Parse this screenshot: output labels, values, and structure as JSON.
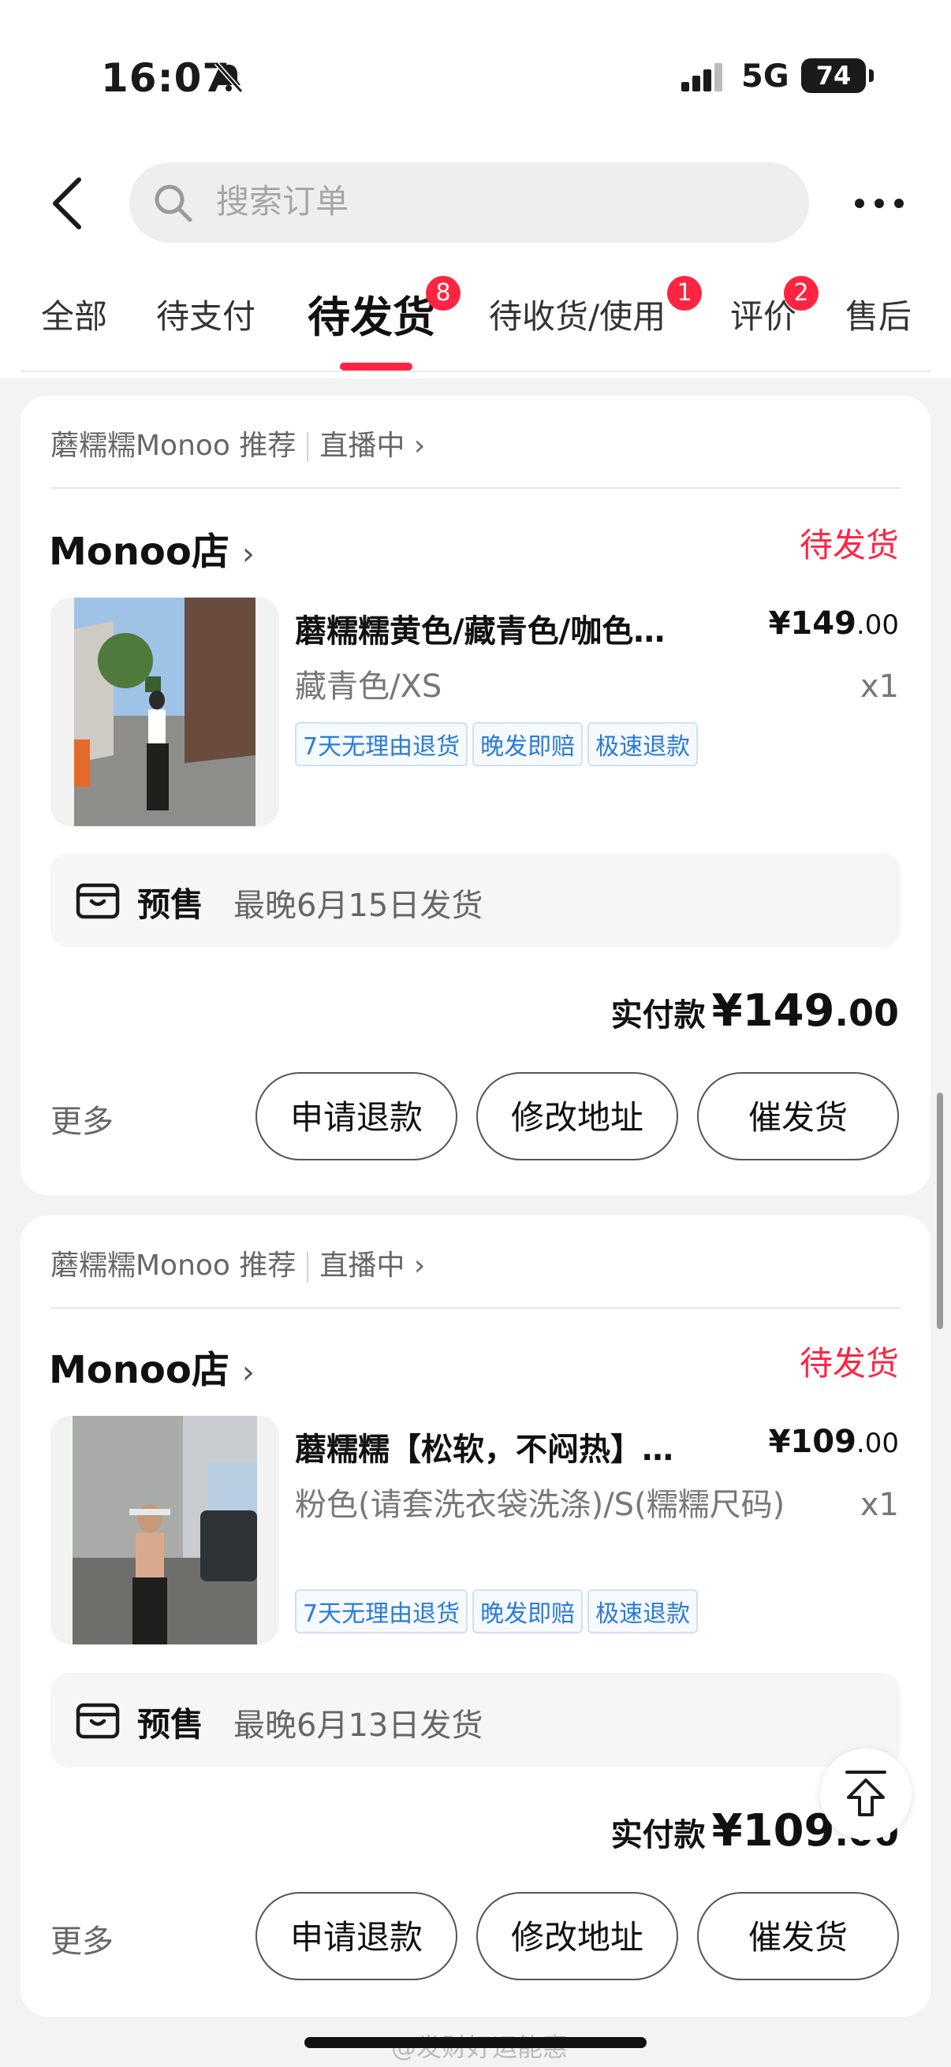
{
  "status_bar": {
    "time": "16:07",
    "network": "5G",
    "battery": "74"
  },
  "search": {
    "placeholder": "搜索订单"
  },
  "tabs": [
    {
      "label": "全部"
    },
    {
      "label": "待支付"
    },
    {
      "label": "待发货",
      "badge": "8",
      "active": true
    },
    {
      "label": "待收货/使用",
      "badge": "1"
    },
    {
      "label": "评价",
      "badge": "2"
    },
    {
      "label": "售后"
    }
  ],
  "orders": [
    {
      "source": "蘑糯糯Monoo 推荐",
      "source_link": "直播中",
      "shop": "Monoo店",
      "status": "待发货",
      "product": "蘑糯糯黄色/藏青色/咖色…",
      "price_main": "¥149",
      "price_dec": ".00",
      "spec": "藏青色/XS",
      "qty": "x1",
      "tags": [
        "7天无理由退货",
        "晚发即赔",
        "极速退款"
      ],
      "presale_label": "预售",
      "presale_text": "最晚6月15日发货",
      "paid_label": "实付款",
      "paid_main": "¥149",
      "paid_dec": ".00",
      "more": "更多",
      "buttons": [
        "申请退款",
        "修改地址",
        "催发货"
      ]
    },
    {
      "source": "蘑糯糯Monoo 推荐",
      "source_link": "直播中",
      "shop": "Monoo店",
      "status": "待发货",
      "product": "蘑糯糯【松软，不闷热】…",
      "price_main": "¥109",
      "price_dec": ".00",
      "spec": "粉色(请套洗衣袋洗涤)/S(糯糯尺码)",
      "qty": "x1",
      "tags": [
        "7天无理由退货",
        "晚发即赔",
        "极速退款"
      ],
      "presale_label": "预售",
      "presale_text": "最晚6月13日发货",
      "paid_label": "实付款",
      "paid_main": "¥109",
      "paid_dec": ".00",
      "more": "更多",
      "buttons": [
        "申请退款",
        "修改地址",
        "催发货"
      ]
    }
  ],
  "watermark": "@发财好运能惠",
  "colors": {
    "accent": "#ff2442",
    "tag": "#2a7bd8"
  }
}
